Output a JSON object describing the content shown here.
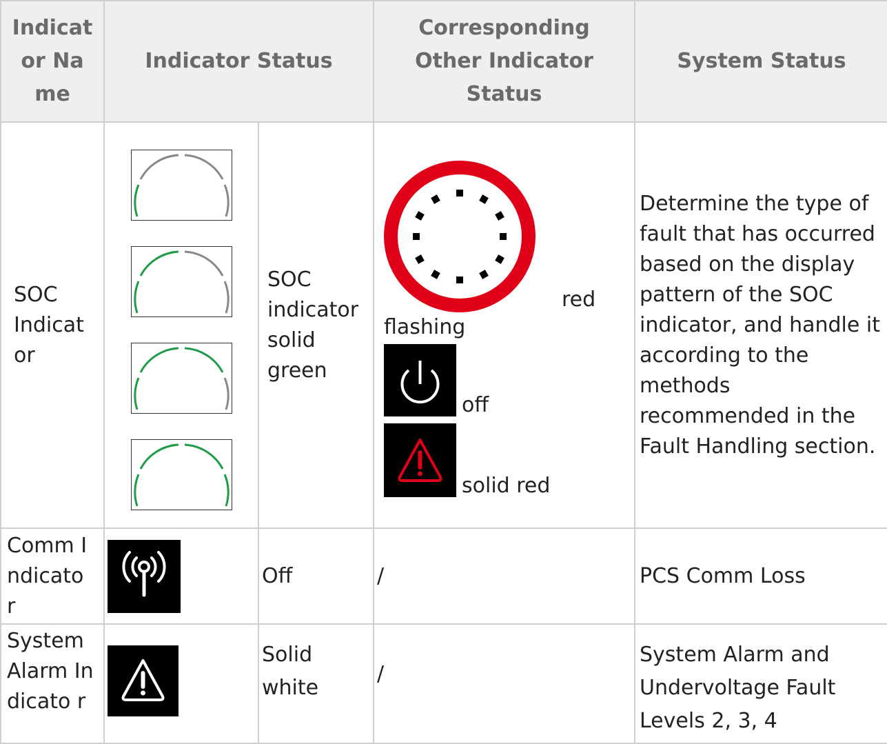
{
  "headers": {
    "name": "Indicat or Name",
    "status": "Indicator Status",
    "other": "Corresponding Other Indicator Status",
    "system": "System Status"
  },
  "rows": [
    {
      "name": "SOC Indicat or",
      "status_text": "SOC indicator solid green",
      "soc_icons": [
        "soc-quarter-icon",
        "soc-half-icon",
        "soc-three-quarter-icon",
        "soc-full-icon"
      ],
      "other": [
        {
          "icon": "red-flashing-ring-icon",
          "label": "red",
          "label2": "flashing"
        },
        {
          "icon": "power-off-icon",
          "label": "off"
        },
        {
          "icon": "red-warning-icon",
          "label": "solid red"
        }
      ],
      "system": "Determine the type of fault that has occurred based on the display pattern of the SOC indicator, and handle it according to the methods recommended in the Fault Handling section."
    },
    {
      "name": "Comm Indicato r",
      "icon": "antenna-icon",
      "status_text": "Off",
      "other": "/",
      "system": "PCS Comm Loss"
    },
    {
      "name": "System Alarm Indicato r",
      "icon": "white-warning-icon",
      "status_text": "Solid white",
      "other": "/",
      "system": "System Alarm and Undervoltage Fault Levels 2, 3, 4"
    }
  ],
  "colors": {
    "green": "#1e9b48",
    "red": "#e00018",
    "header_bg": "#efefef",
    "header_text": "#6a6a6a",
    "border": "#cfcfcf"
  }
}
